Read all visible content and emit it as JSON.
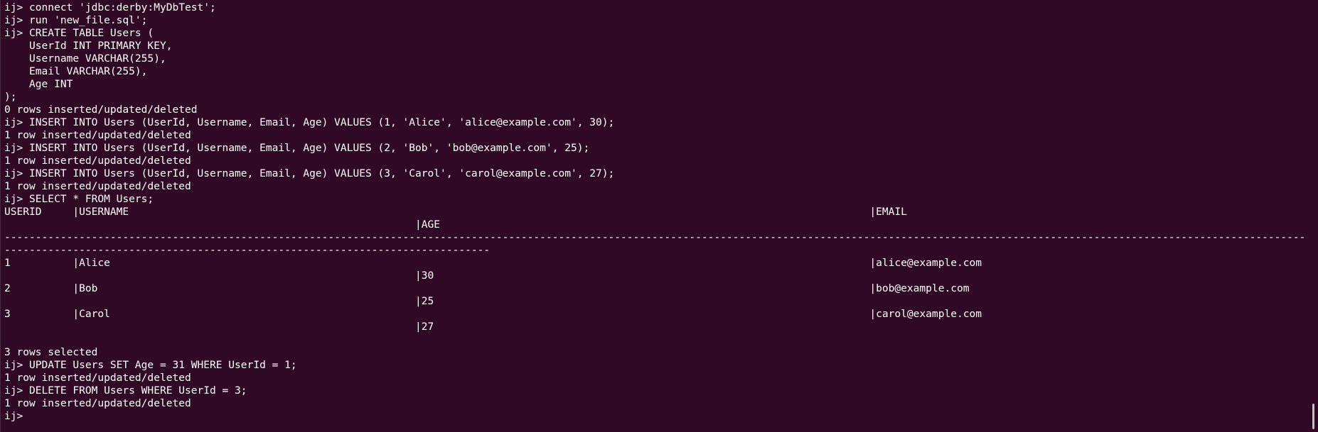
{
  "terminal": {
    "lines": [
      "ij> connect 'jdbc:derby:MyDbTest';",
      "ij> run 'new_file.sql';",
      "ij> CREATE TABLE Users (",
      "    UserId INT PRIMARY KEY,",
      "    Username VARCHAR(255),",
      "    Email VARCHAR(255),",
      "    Age INT",
      ");",
      "0 rows inserted/updated/deleted",
      "ij> INSERT INTO Users (UserId, Username, Email, Age) VALUES (1, 'Alice', 'alice@example.com', 30);",
      "1 row inserted/updated/deleted",
      "ij> INSERT INTO Users (UserId, Username, Email, Age) VALUES (2, 'Bob', 'bob@example.com', 25);",
      "1 row inserted/updated/deleted",
      "ij> INSERT INTO Users (UserId, Username, Email, Age) VALUES (3, 'Carol', 'carol@example.com', 27);",
      "1 row inserted/updated/deleted",
      "ij> SELECT * FROM Users;",
      "USERID     |USERNAME                                                                                                                       |EMAIL",
      "                                                                  |AGE",
      "---------------------------------------------------------------------------------------------------------------------------------------------------------------------------------------------------------------------------",
      "------------------------------------------------------------------------------",
      "1          |Alice                                                                                                                          |alice@example.com",
      "                                                                  |30",
      "2          |Bob                                                                                                                            |bob@example.com",
      "                                                                  |25",
      "3          |Carol                                                                                                                          |carol@example.com",
      "                                                                  |27",
      "",
      "3 rows selected",
      "ij> UPDATE Users SET Age = 31 WHERE UserId = 1;",
      "1 row inserted/updated/deleted",
      "ij> DELETE FROM Users WHERE UserId = 3;",
      "1 row inserted/updated/deleted"
    ],
    "prompt": "ij>",
    "colors": {
      "background": "#300a24",
      "foreground": "#ffffff",
      "scrollbar_thumb": "#c9bcc4"
    }
  }
}
